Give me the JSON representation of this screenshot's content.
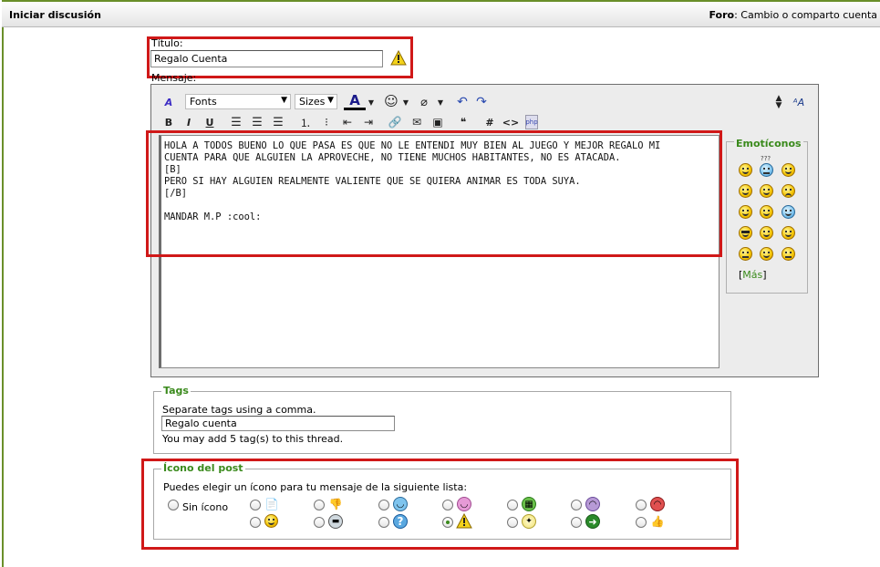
{
  "header": {
    "title": "Iniciar discusión",
    "forum_label": "Foro",
    "forum_name": ": Cambio o comparto cuenta"
  },
  "title_field": {
    "label": "Título:",
    "value": "Regalo Cuenta"
  },
  "message_label": "Mensaje:",
  "toolbar": {
    "font_select": "Fonts",
    "size_select": "Sizes",
    "bold": "B",
    "italic": "I",
    "underline": "U",
    "hash": "#",
    "code": "<>"
  },
  "message_text": "HOLA A TODOS BUENO LO QUE PASA ES QUE NO LE ENTENDI MUY BIEN AL JUEGO Y MEJOR REGALO MI\nCUENTA PARA QUE ALGUIEN LA APROVECHE, NO TIENE MUCHOS HABITANTES, NO ES ATACADA.\n[B]\nPERO SI HAY ALGUIEN REALMENTE VALIENTE QUE SE QUIERA ANIMAR ES TODA SUYA.\n[/B]\n\nMANDAR M.P :cool:",
  "emoticons": {
    "legend": "Emotíconos",
    "more_open": "[",
    "more_label": "Más",
    "more_close": "]",
    "question_mark": "???"
  },
  "tags": {
    "legend": "Tags",
    "hint": "Separate tags using a comma.",
    "value": "Regalo cuenta",
    "note": "You may add 5 tag(s) to this thread."
  },
  "post_icon": {
    "legend": "Ícono del post",
    "instruction": "Puedes elegir un ícono para tu mensaje de la siguiente lista:",
    "no_icon_label": "Sin ícono",
    "icons": [
      "document-icon",
      "thumbs-down-icon",
      "smile-blue-icon",
      "tongue-icon",
      "grin-icon",
      "sad-icon",
      "angry-icon",
      "smile-icon",
      "cool-icon",
      "question-icon",
      "warning-icon",
      "lightbulb-icon",
      "arrow-icon",
      "thumbs-up-icon"
    ],
    "selected_index": 10
  },
  "colors": {
    "accent": "#3a8a1c",
    "highlight": "#d01818",
    "frame": "#6a8f2a"
  }
}
